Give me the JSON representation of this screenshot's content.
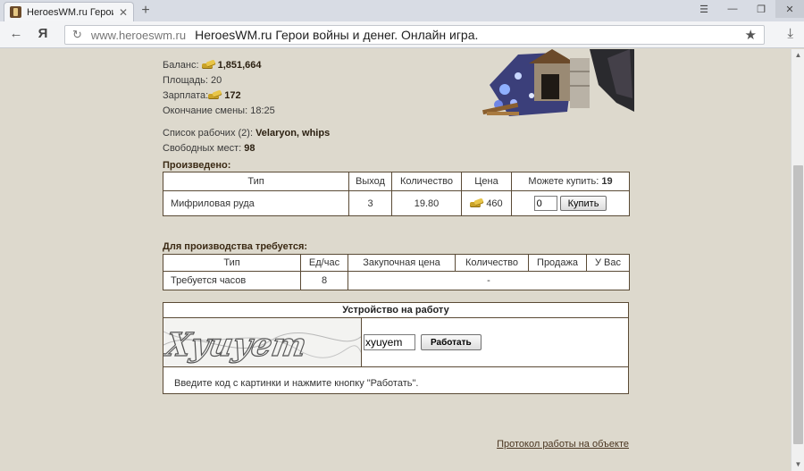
{
  "browser": {
    "tab_title": "HeroesWM.ru Герои в",
    "url_host": "www.heroeswm.ru",
    "page_title": "HeroesWM.ru Герои войны и денег. Онлайн игра."
  },
  "info": {
    "balance_label": "Баланс:",
    "balance_value": "1,851,664",
    "area_label": "Площадь:",
    "area_value": "20",
    "salary_label": "Зарплата:",
    "salary_value": "172",
    "shift_end_label": "Окончание смены:",
    "shift_end_value": "18:25",
    "workers_label": "Список рабочих (2):",
    "workers_names": "Velaryon, whips",
    "free_places_label": "Свободных мест:",
    "free_places_value": "98"
  },
  "produced": {
    "title": "Произведено:",
    "headers": {
      "type": "Тип",
      "output": "Выход",
      "quantity": "Количество",
      "price": "Цена",
      "can_buy_label": "Можете купить:",
      "can_buy_value": "19"
    },
    "row": {
      "type": "Мифриловая руда",
      "output": "3",
      "quantity": "19.80",
      "price": "460",
      "buy_qty": "0",
      "buy_button": "Купить"
    }
  },
  "required": {
    "title": "Для производства требуется:",
    "headers": [
      "Тип",
      "Ед/час",
      "Закупочная цена",
      "Количество",
      "Продажа",
      "У Вас"
    ],
    "row": {
      "type": "Требуется часов",
      "per_hour": "8",
      "rest": "-"
    }
  },
  "job": {
    "title": "Устройство на работу",
    "code_value": "xyuyem",
    "work_button": "Работать",
    "hint": "Введите код с картинки и нажмите кнопку \"Работать\".",
    "captcha_text": "Xyuyem"
  },
  "protocol_link": "Протокол работы на объекте",
  "colors": {
    "page_bg": "#ddd9cd",
    "table_border": "#5a4a35",
    "gold": "#c9a227"
  }
}
